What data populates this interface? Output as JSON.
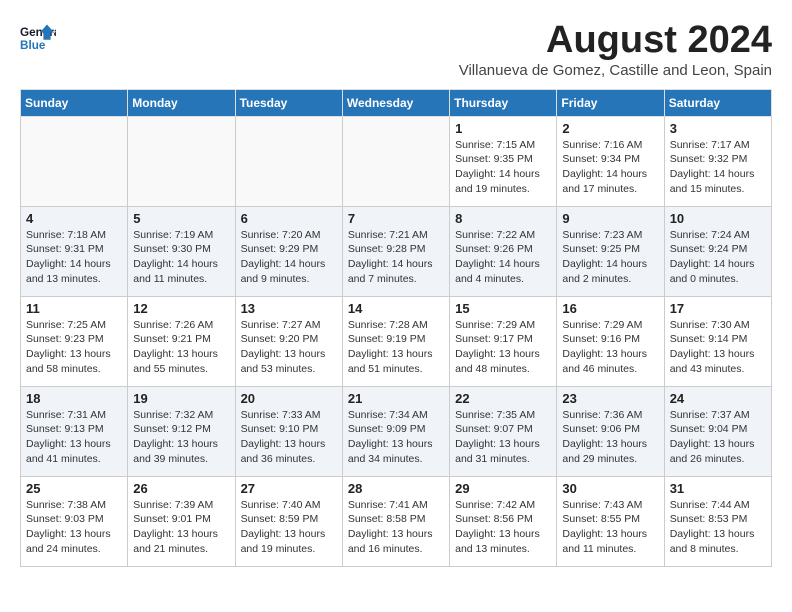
{
  "header": {
    "logo_line1": "General",
    "logo_line2": "Blue",
    "month_year": "August 2024",
    "location": "Villanueva de Gomez, Castille and Leon, Spain"
  },
  "days_of_week": [
    "Sunday",
    "Monday",
    "Tuesday",
    "Wednesday",
    "Thursday",
    "Friday",
    "Saturday"
  ],
  "weeks": [
    {
      "alt": false,
      "days": [
        {
          "num": "",
          "info": ""
        },
        {
          "num": "",
          "info": ""
        },
        {
          "num": "",
          "info": ""
        },
        {
          "num": "",
          "info": ""
        },
        {
          "num": "1",
          "info": "Sunrise: 7:15 AM\nSunset: 9:35 PM\nDaylight: 14 hours\nand 19 minutes."
        },
        {
          "num": "2",
          "info": "Sunrise: 7:16 AM\nSunset: 9:34 PM\nDaylight: 14 hours\nand 17 minutes."
        },
        {
          "num": "3",
          "info": "Sunrise: 7:17 AM\nSunset: 9:32 PM\nDaylight: 14 hours\nand 15 minutes."
        }
      ]
    },
    {
      "alt": true,
      "days": [
        {
          "num": "4",
          "info": "Sunrise: 7:18 AM\nSunset: 9:31 PM\nDaylight: 14 hours\nand 13 minutes."
        },
        {
          "num": "5",
          "info": "Sunrise: 7:19 AM\nSunset: 9:30 PM\nDaylight: 14 hours\nand 11 minutes."
        },
        {
          "num": "6",
          "info": "Sunrise: 7:20 AM\nSunset: 9:29 PM\nDaylight: 14 hours\nand 9 minutes."
        },
        {
          "num": "7",
          "info": "Sunrise: 7:21 AM\nSunset: 9:28 PM\nDaylight: 14 hours\nand 7 minutes."
        },
        {
          "num": "8",
          "info": "Sunrise: 7:22 AM\nSunset: 9:26 PM\nDaylight: 14 hours\nand 4 minutes."
        },
        {
          "num": "9",
          "info": "Sunrise: 7:23 AM\nSunset: 9:25 PM\nDaylight: 14 hours\nand 2 minutes."
        },
        {
          "num": "10",
          "info": "Sunrise: 7:24 AM\nSunset: 9:24 PM\nDaylight: 14 hours\nand 0 minutes."
        }
      ]
    },
    {
      "alt": false,
      "days": [
        {
          "num": "11",
          "info": "Sunrise: 7:25 AM\nSunset: 9:23 PM\nDaylight: 13 hours\nand 58 minutes."
        },
        {
          "num": "12",
          "info": "Sunrise: 7:26 AM\nSunset: 9:21 PM\nDaylight: 13 hours\nand 55 minutes."
        },
        {
          "num": "13",
          "info": "Sunrise: 7:27 AM\nSunset: 9:20 PM\nDaylight: 13 hours\nand 53 minutes."
        },
        {
          "num": "14",
          "info": "Sunrise: 7:28 AM\nSunset: 9:19 PM\nDaylight: 13 hours\nand 51 minutes."
        },
        {
          "num": "15",
          "info": "Sunrise: 7:29 AM\nSunset: 9:17 PM\nDaylight: 13 hours\nand 48 minutes."
        },
        {
          "num": "16",
          "info": "Sunrise: 7:29 AM\nSunset: 9:16 PM\nDaylight: 13 hours\nand 46 minutes."
        },
        {
          "num": "17",
          "info": "Sunrise: 7:30 AM\nSunset: 9:14 PM\nDaylight: 13 hours\nand 43 minutes."
        }
      ]
    },
    {
      "alt": true,
      "days": [
        {
          "num": "18",
          "info": "Sunrise: 7:31 AM\nSunset: 9:13 PM\nDaylight: 13 hours\nand 41 minutes."
        },
        {
          "num": "19",
          "info": "Sunrise: 7:32 AM\nSunset: 9:12 PM\nDaylight: 13 hours\nand 39 minutes."
        },
        {
          "num": "20",
          "info": "Sunrise: 7:33 AM\nSunset: 9:10 PM\nDaylight: 13 hours\nand 36 minutes."
        },
        {
          "num": "21",
          "info": "Sunrise: 7:34 AM\nSunset: 9:09 PM\nDaylight: 13 hours\nand 34 minutes."
        },
        {
          "num": "22",
          "info": "Sunrise: 7:35 AM\nSunset: 9:07 PM\nDaylight: 13 hours\nand 31 minutes."
        },
        {
          "num": "23",
          "info": "Sunrise: 7:36 AM\nSunset: 9:06 PM\nDaylight: 13 hours\nand 29 minutes."
        },
        {
          "num": "24",
          "info": "Sunrise: 7:37 AM\nSunset: 9:04 PM\nDaylight: 13 hours\nand 26 minutes."
        }
      ]
    },
    {
      "alt": false,
      "days": [
        {
          "num": "25",
          "info": "Sunrise: 7:38 AM\nSunset: 9:03 PM\nDaylight: 13 hours\nand 24 minutes."
        },
        {
          "num": "26",
          "info": "Sunrise: 7:39 AM\nSunset: 9:01 PM\nDaylight: 13 hours\nand 21 minutes."
        },
        {
          "num": "27",
          "info": "Sunrise: 7:40 AM\nSunset: 8:59 PM\nDaylight: 13 hours\nand 19 minutes."
        },
        {
          "num": "28",
          "info": "Sunrise: 7:41 AM\nSunset: 8:58 PM\nDaylight: 13 hours\nand 16 minutes."
        },
        {
          "num": "29",
          "info": "Sunrise: 7:42 AM\nSunset: 8:56 PM\nDaylight: 13 hours\nand 13 minutes."
        },
        {
          "num": "30",
          "info": "Sunrise: 7:43 AM\nSunset: 8:55 PM\nDaylight: 13 hours\nand 11 minutes."
        },
        {
          "num": "31",
          "info": "Sunrise: 7:44 AM\nSunset: 8:53 PM\nDaylight: 13 hours\nand 8 minutes."
        }
      ]
    }
  ]
}
